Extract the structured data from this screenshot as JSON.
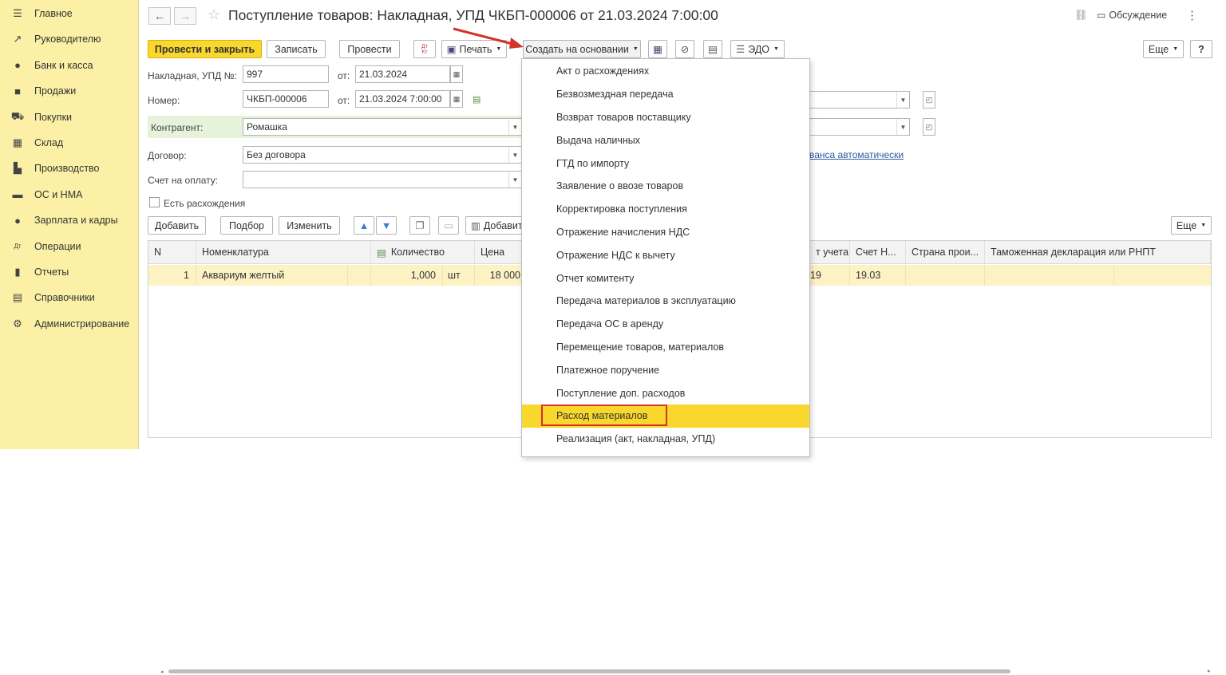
{
  "sidebar": {
    "items": [
      {
        "icon": "menu-icon",
        "glyph": "☰",
        "label": "Главное"
      },
      {
        "icon": "trend-icon",
        "glyph": "↗",
        "label": "Руководителю"
      },
      {
        "icon": "coin-icon",
        "glyph": "●",
        "label": "Банк и касса"
      },
      {
        "icon": "bag-icon",
        "glyph": "■",
        "label": "Продажи"
      },
      {
        "icon": "cart-icon",
        "glyph": "⛟",
        "label": "Покупки"
      },
      {
        "icon": "warehouse-icon",
        "glyph": "▦",
        "label": "Склад"
      },
      {
        "icon": "factory-icon",
        "glyph": "▙",
        "label": "Производство"
      },
      {
        "icon": "truck-icon",
        "glyph": "▬",
        "label": "ОС и НМА"
      },
      {
        "icon": "person-icon",
        "glyph": "●",
        "label": "Зарплата и кадры"
      },
      {
        "icon": "dtkt-icon",
        "glyph": "Дт",
        "label": "Операции"
      },
      {
        "icon": "bar-chart-icon",
        "glyph": "▮",
        "label": "Отчеты"
      },
      {
        "icon": "book-icon",
        "glyph": "▤",
        "label": "Справочники"
      },
      {
        "icon": "gear-icon",
        "glyph": "⚙",
        "label": "Администрирование"
      }
    ]
  },
  "header": {
    "title": "Поступление товаров: Накладная, УПД ЧКБП-000006 от 21.03.2024 7:00:00",
    "discussion": "Обсуждение",
    "back_glyph": "←",
    "forward_glyph": "→",
    "star_glyph": "☆",
    "link_glyph": "🔗",
    "more_glyph": "⋮"
  },
  "toolbar": {
    "post_close": "Провести и закрыть",
    "save": "Записать",
    "post": "Провести",
    "dtkt": "Дт Кт",
    "print": "Печать",
    "create_based": "Создать на основании",
    "edo": "ЭДО",
    "more": "Еще",
    "help": "?"
  },
  "form": {
    "invoice_label": "Накладная, УПД №:",
    "invoice_no": "997",
    "from_label": "от:",
    "invoice_date": "21.03.2024",
    "number_label": "Номер:",
    "number": "ЧКБП-000006",
    "number_date": "21.03.2024  7:00:00",
    "contragent_label": "Контрагент:",
    "contragent": "Ромашка",
    "contract_label": "Договор:",
    "contract": "Без договора",
    "payment_label": "Счет на оплату:",
    "payment": "",
    "discrepancy_label": "Есть расхождения",
    "advance_link": "ванса автоматически"
  },
  "table_toolbar": {
    "add": "Добавить",
    "pick": "Подбор",
    "change": "Изменить",
    "add2": "Добавит",
    "more": "Еще"
  },
  "table": {
    "headers": [
      "N",
      "Номенклатура",
      "Количество",
      "Цена",
      "т учета",
      "Счет Н...",
      "Страна прои...",
      "Таможенная декларация или РНПТ"
    ],
    "row": {
      "n": "1",
      "name": "Аквариум желтый",
      "qty": "1,000",
      "unit": "шт",
      "price": "18 000",
      "account": "19",
      "vat_account": "19.03"
    }
  },
  "menu": {
    "items": [
      "Акт о расхождениях",
      "Безвозмездная передача",
      "Возврат товаров поставщику",
      "Выдача наличных",
      "ГТД по импорту",
      "Заявление о ввозе товаров",
      "Корректировка поступления",
      "Отражение начисления НДС",
      "Отражение НДС к вычету",
      "Отчет комитенту",
      "Передача материалов в эксплуатацию",
      "Передача ОС в аренду",
      "Перемещение товаров, материалов",
      "Платежное поручение",
      "Поступление доп. расходов",
      "Расход материалов",
      "Реализация (акт, накладная, УПД)"
    ],
    "selected_index": 15
  },
  "colors": {
    "accent": "#f9d72c",
    "sidebar": "#fbf0a5",
    "arrow": "#d2332b",
    "highlight_row": "#fdf2c4"
  }
}
